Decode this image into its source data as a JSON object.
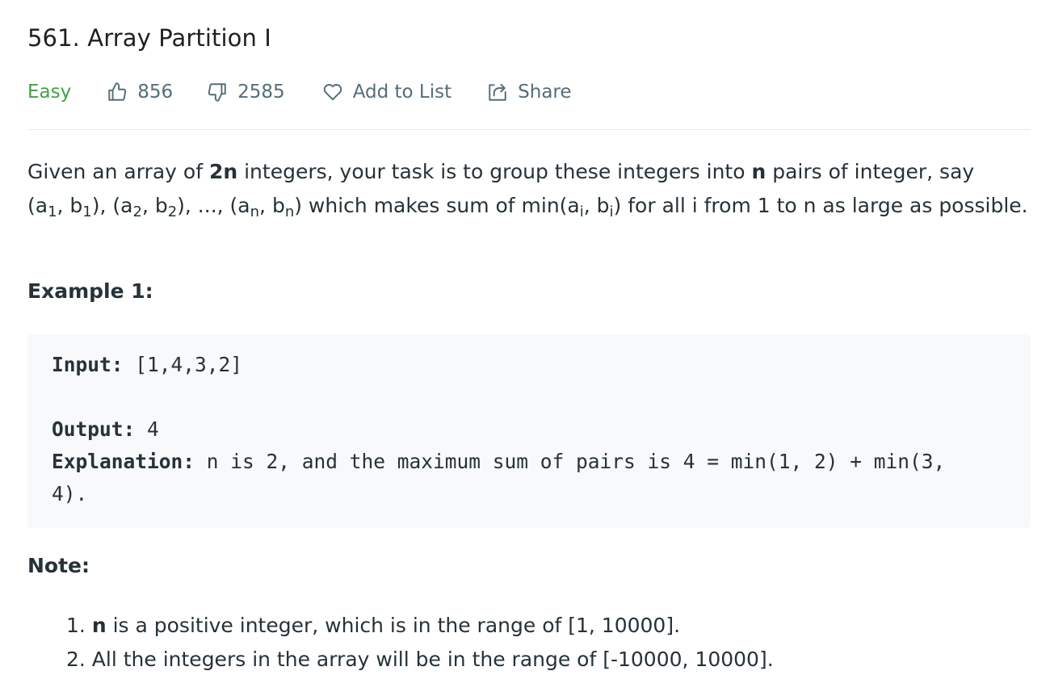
{
  "problem": {
    "title": "561. Array Partition I",
    "difficulty": "Easy",
    "likes": "856",
    "dislikes": "2585",
    "add_to_list_label": "Add to List",
    "share_label": "Share"
  },
  "description": {
    "p1_start": "Given an array of ",
    "p1_bold_2n": "2n",
    "p1_mid": " integers, your task is to group these integers into ",
    "p1_bold_n": "n",
    "p1_end": " pairs of integer, say",
    "tup_open_a1": "(a",
    "sub_1a": "1",
    "tup_b1": ", b",
    "sub_1b": "1",
    "tup_a2": "), (a",
    "sub_2a": "2",
    "tup_b2": ", b",
    "sub_2b": "2",
    "tup_an": "), ..., (a",
    "sub_na": "n",
    "tup_bn": ", b",
    "sub_nb": "n",
    "tup_min": ") which makes sum of min(a",
    "sub_ia": "i",
    "tup_bi": ", b",
    "sub_ib": "i",
    "tail": ") for all i from 1 to n as large as possible."
  },
  "example1": {
    "title": "Example 1:",
    "input_label": "Input:",
    "input_value": " [1,4,3,2]",
    "output_label": "Output:",
    "output_value": " 4",
    "explanation_label": "Explanation:",
    "explanation_value": " n is 2, and the maximum sum of pairs is 4 = min(1, 2) + min(3, 4)."
  },
  "note": {
    "title": "Note:",
    "item1_num": "1. ",
    "item1_bold": "n",
    "item1_text": " is a positive integer, which is in the range of [1, 10000].",
    "item2_text": "2. All the integers in the array will be in the range of [-10000, 10000]."
  },
  "colors": {
    "difficulty_easy": "#43a047",
    "meta_text": "#546e7a",
    "body_text": "#263238",
    "code_bg": "#f7f9fa"
  },
  "icons": [
    "thumbs-up-icon",
    "thumbs-down-icon",
    "heart-icon",
    "share-icon"
  ]
}
